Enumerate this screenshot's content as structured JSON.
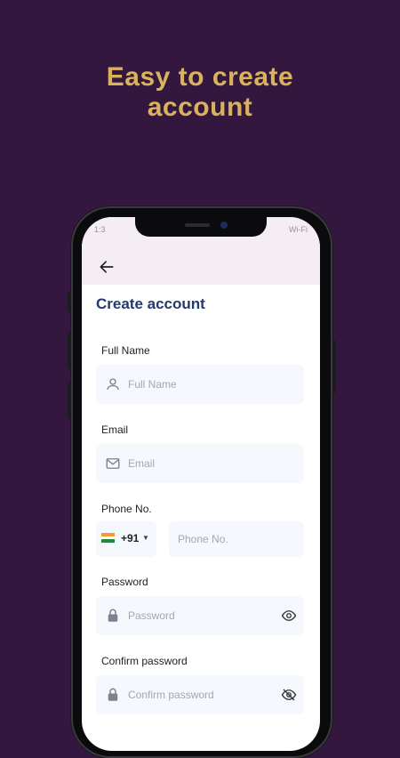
{
  "headline": {
    "line1": "Easy to create",
    "line2": "account"
  },
  "status_bar": {
    "left": "1:3",
    "right": "Wi-Fi"
  },
  "form": {
    "title": "Create account",
    "full_name": {
      "label": "Full Name",
      "placeholder": "Full Name",
      "icon": "person-icon"
    },
    "email": {
      "label": "Email",
      "placeholder": "Email",
      "icon": "mail-icon"
    },
    "phone": {
      "label": "Phone No.",
      "country_code": "+91",
      "placeholder": "Phone No."
    },
    "password": {
      "label": "Password",
      "placeholder": "Password",
      "icon": "lock-icon",
      "toggle": "eye-icon"
    },
    "confirm_password": {
      "label": "Confirm password",
      "placeholder": "Confirm password",
      "icon": "lock-icon",
      "toggle": "eye-off-icon"
    }
  },
  "colors": {
    "background": "#34173f",
    "headline": "#d9b25c",
    "title": "#233a6b",
    "field_bg": "#f5f8fc"
  }
}
